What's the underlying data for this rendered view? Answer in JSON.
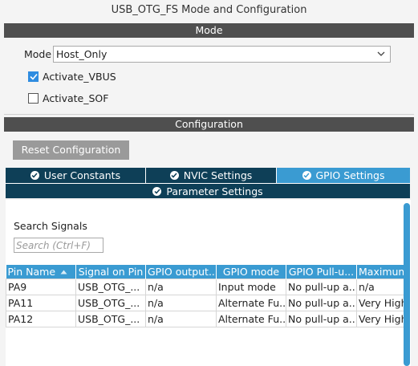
{
  "window": {
    "title": "USB_OTG_FS Mode and Configuration"
  },
  "mode_section": {
    "header": "Mode",
    "mode_label": "Mode",
    "mode_value": "Host_Only",
    "checkboxes": [
      {
        "label": "Activate_VBUS",
        "checked": true
      },
      {
        "label": "Activate_SOF",
        "checked": false
      }
    ]
  },
  "config_section": {
    "header": "Configuration",
    "reset_label": "Reset Configuration",
    "tabs": [
      {
        "label": "User Constants",
        "active": false
      },
      {
        "label": "NVIC Settings",
        "active": false
      },
      {
        "label": "GPIO Settings",
        "active": true
      },
      {
        "label": "Parameter Settings",
        "active": false
      }
    ],
    "search_label": "Search Signals",
    "search_placeholder": "Search (Ctrl+F)",
    "columns": [
      "Pin Name",
      "Signal on Pin",
      "GPIO output...",
      "GPIO mode",
      "GPIO Pull-u...",
      "Maximum"
    ],
    "rows": [
      [
        "PA9",
        "USB_OTG_...",
        "n/a",
        "Input mode",
        "No pull-up a...",
        "n/a"
      ],
      [
        "PA11",
        "USB_OTG_...",
        "n/a",
        "Alternate Fu...",
        "No pull-up a...",
        "Very High"
      ],
      [
        "PA12",
        "USB_OTG_...",
        "n/a",
        "Alternate Fu...",
        "No pull-up a...",
        "Very High"
      ]
    ]
  },
  "colors": {
    "section_bar": "#4f4f4f",
    "tab_dark": "#0e3f57",
    "tab_active": "#3a9bd2",
    "checkbox_checked": "#2f8ce0"
  }
}
